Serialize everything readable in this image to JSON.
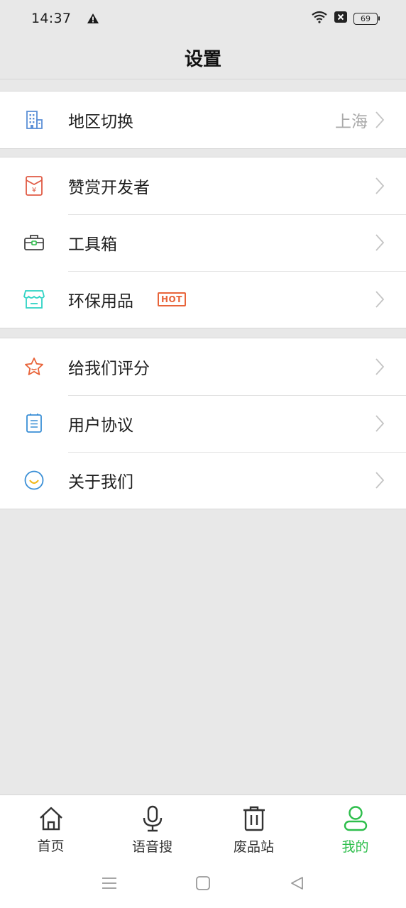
{
  "status": {
    "time": "14:37",
    "battery": "69"
  },
  "header": {
    "title": "设置"
  },
  "groups": [
    {
      "items": [
        {
          "label": "地区切换",
          "value": "上海",
          "icon": "building-icon"
        }
      ]
    },
    {
      "items": [
        {
          "label": "赞赏开发者",
          "icon": "red-envelope-icon"
        },
        {
          "label": "工具箱",
          "icon": "toolbox-icon"
        },
        {
          "label": "环保用品",
          "badge": "HOT",
          "icon": "store-icon"
        }
      ]
    },
    {
      "items": [
        {
          "label": "给我们评分",
          "icon": "star-icon"
        },
        {
          "label": "用户协议",
          "icon": "document-icon"
        },
        {
          "label": "关于我们",
          "icon": "smile-icon"
        }
      ]
    }
  ],
  "tabbar": [
    {
      "label": "首页",
      "icon": "home-icon"
    },
    {
      "label": "语音搜",
      "icon": "microphone-icon"
    },
    {
      "label": "废品站",
      "icon": "trash-icon"
    },
    {
      "label": "我的",
      "icon": "user-icon",
      "active": true
    }
  ],
  "colors": {
    "accent": "#2dbe4b",
    "hot": "#e8643a",
    "muted": "#aaaaaa"
  }
}
